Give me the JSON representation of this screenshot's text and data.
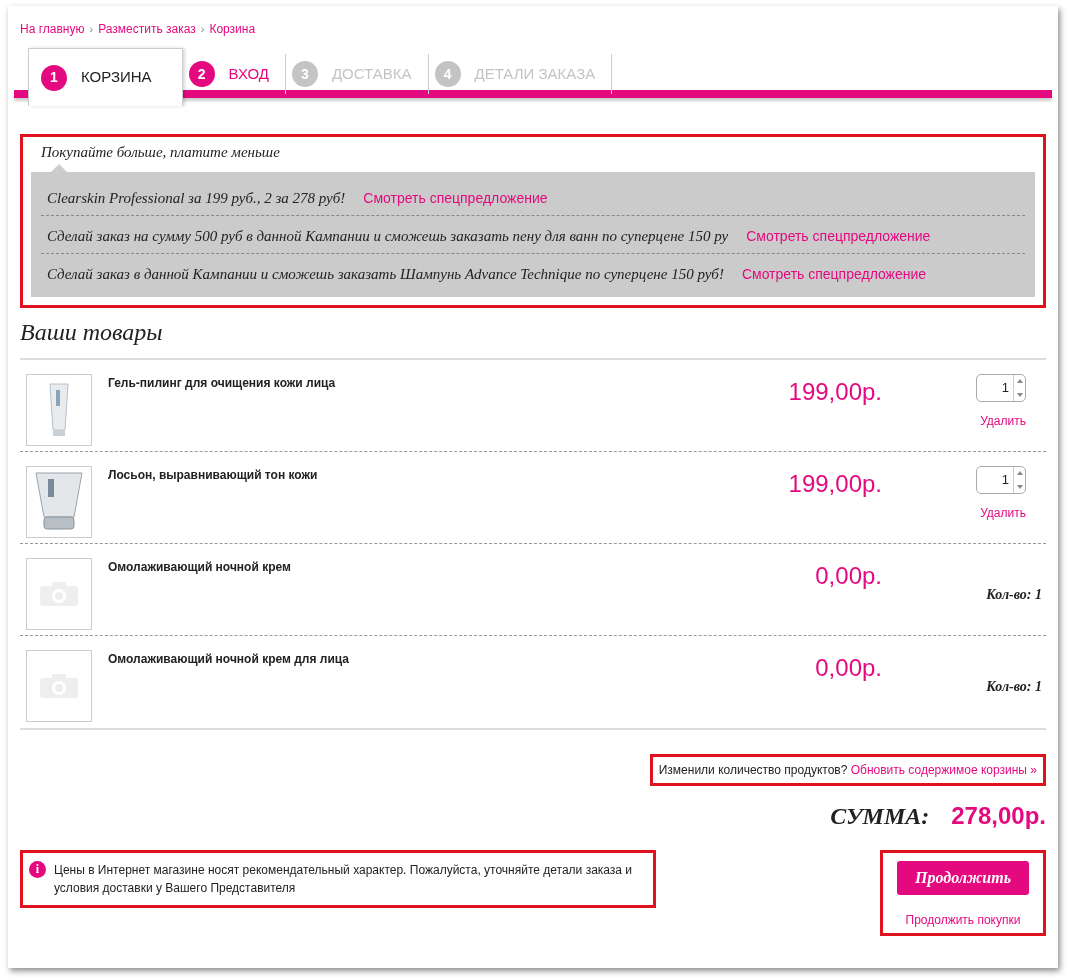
{
  "breadcrumbs": {
    "separator": "›",
    "items": [
      "На главную",
      "Разместить заказ",
      "Корзина"
    ]
  },
  "steps": [
    {
      "number": "1",
      "label": "КОРЗИНА",
      "selected": true,
      "disabled": false
    },
    {
      "number": "2",
      "label": "ВХОД",
      "selected": false,
      "disabled": false
    },
    {
      "number": "3",
      "label": "ДОСТАВКА",
      "selected": false,
      "disabled": true
    },
    {
      "number": "4",
      "label": "ДЕТАЛИ ЗАКАЗА",
      "selected": false,
      "disabled": true
    }
  ],
  "promo": {
    "title": "Покупайте больше, платите меньше",
    "offers": [
      {
        "text": "Clearskin Professional за 199 руб., 2 за 278 руб!",
        "link": "Смотреть спецпредложение"
      },
      {
        "text": "Сделай заказ на сумму 500 руб в данной Кампании и сможешь заказать пену для ванн по суперцене 150 ру",
        "link": "Смотреть спецпредложение"
      },
      {
        "text": "Сделай заказ в данной Кампании и сможешь заказать Шампунь Advance Technique по суперцене 150 руб!",
        "link": "Смотреть спецпредложение"
      }
    ]
  },
  "products_title": "Ваши товары",
  "products": [
    {
      "kind": "editable",
      "name": "Гель-пилинг для очищения кожи лица",
      "price": "199,00р.",
      "quantity": "1",
      "remove": "Удалить"
    },
    {
      "kind": "editable",
      "name": "Лосьон, выравнивающий тон кожи",
      "price": "199,00р.",
      "quantity": "1",
      "remove": "Удалить"
    },
    {
      "kind": "fixed",
      "name": "Омолаживающий ночной крем",
      "price": "0,00р.",
      "quantity_label": "Кол-во: 1"
    },
    {
      "kind": "fixed",
      "name": "Омолаживающий ночной крем для лица",
      "price": "0,00р.",
      "quantity_label": "Кол-во: 1"
    }
  ],
  "update": {
    "question": "Изменили количество продуктов?",
    "link": "Обновить содержимое корзины »"
  },
  "total": {
    "label": "СУММА:",
    "value": "278,00р."
  },
  "notice": {
    "icon": "i",
    "text": "Цены в Интернет магазине носят рекомендательный характер. Пожалуйста, уточняйте детали заказа и условия доставки у Вашего Представителя"
  },
  "actions": {
    "continue": "Продолжить",
    "continue_shopping": "Продолжить покупки"
  }
}
